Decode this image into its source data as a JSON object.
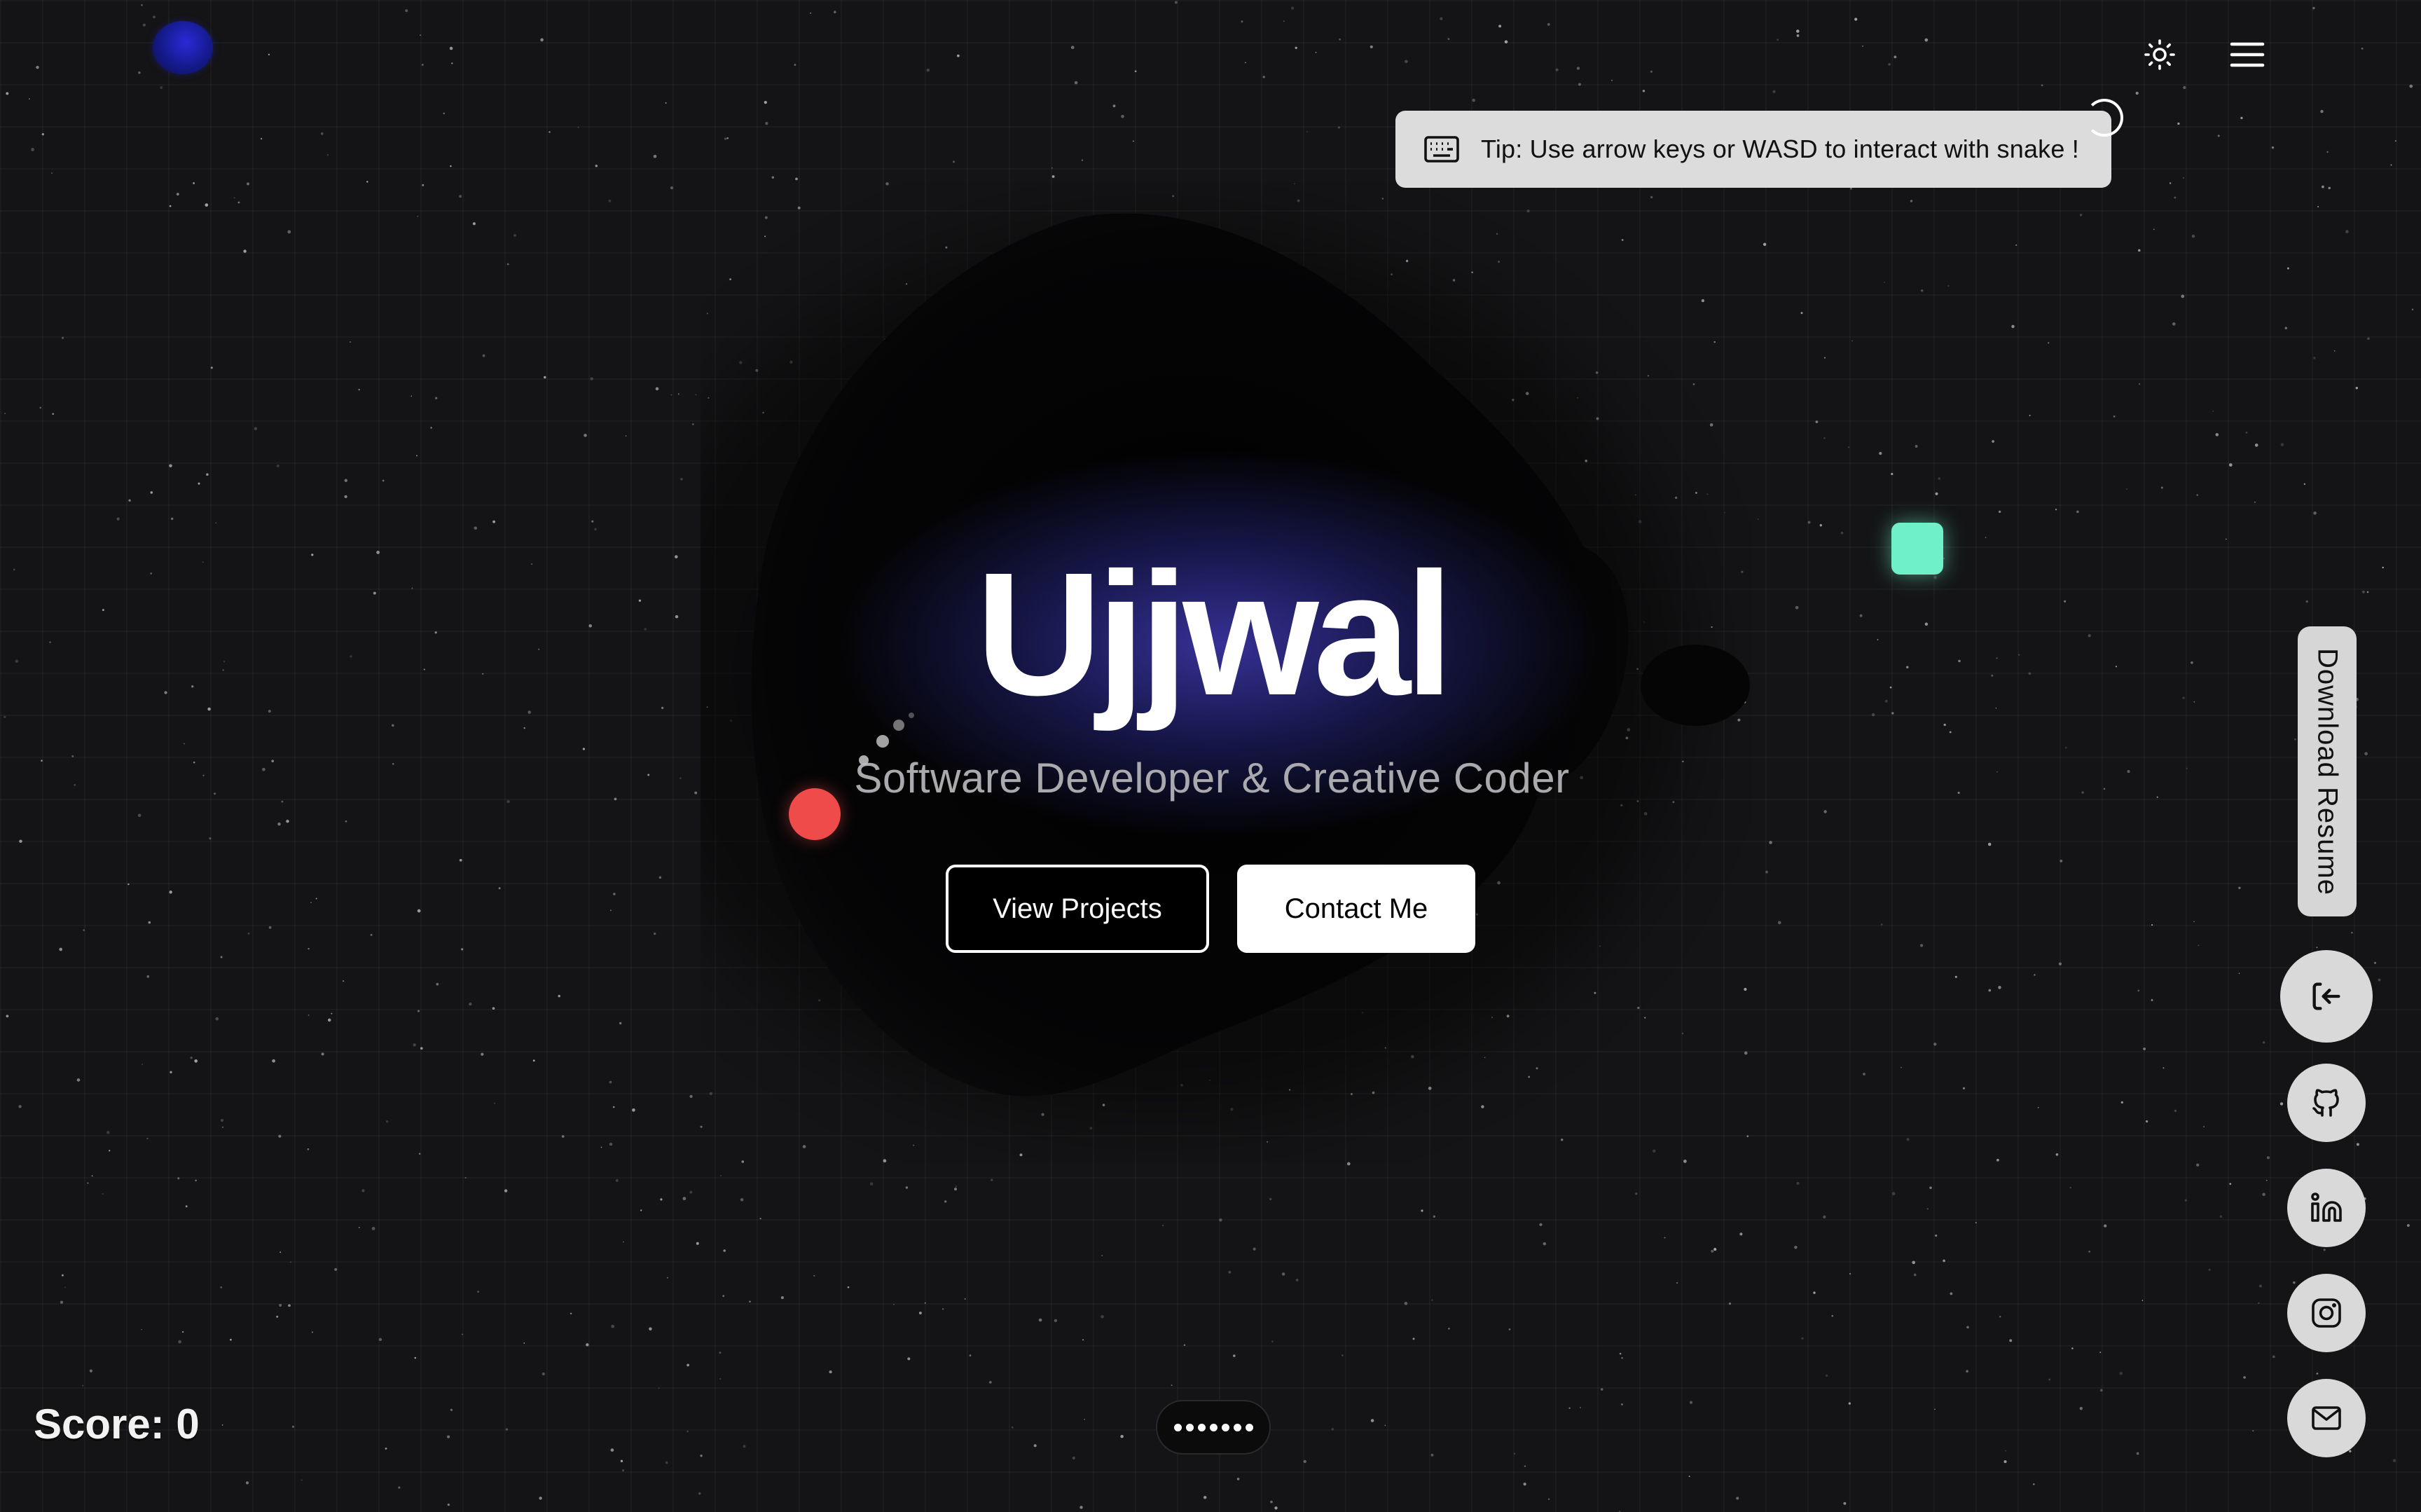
{
  "header": {
    "logo_icon": "orb-logo-icon",
    "theme_toggle_icon": "sun-icon",
    "menu_icon": "hamburger-menu-icon"
  },
  "tip": {
    "icon": "keyboard-icon",
    "text": "Tip: Use arrow keys or WASD to interact with snake !"
  },
  "hero": {
    "name": "Ujjwal",
    "subtitle": "Software Developer & Creative Coder"
  },
  "buttons": {
    "view_projects": "View Projects",
    "contact_me": "Contact Me"
  },
  "sidebar": {
    "download_resume": "Download Resume",
    "icons": [
      "exit-arrow-icon",
      "github-icon",
      "linkedin-icon",
      "instagram-icon",
      "mail-icon"
    ]
  },
  "game": {
    "score_text": "Score: 0",
    "snake_head_color": "#ef4b4b",
    "food_color": "#6ff0c8"
  },
  "pager": {
    "dot_count": 7
  },
  "colors": {
    "background": "#141416",
    "accent_glow": "#4842c8",
    "button_light": "#ffffff",
    "pill_gray": "#d9d9d9"
  }
}
